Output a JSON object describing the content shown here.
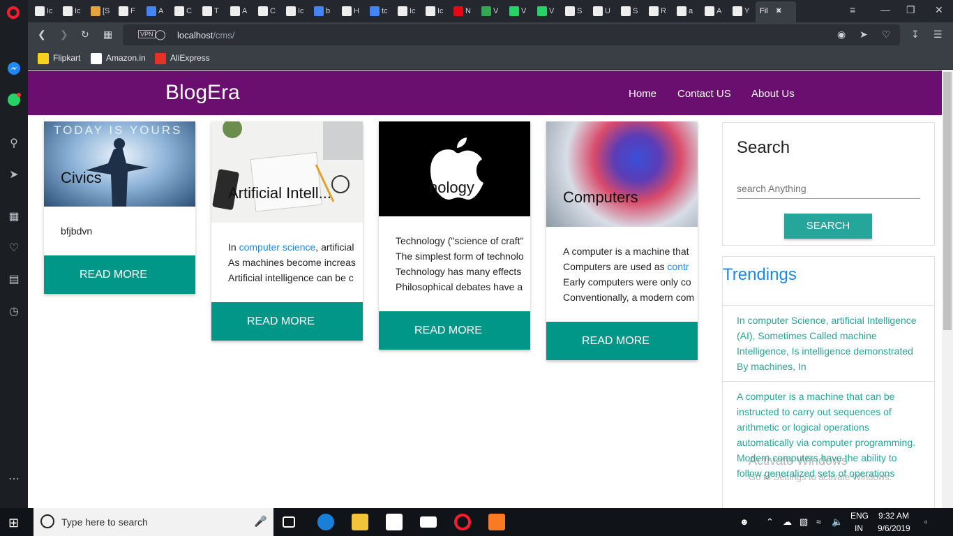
{
  "browser": {
    "url_host": "localhost",
    "url_path": "/cms/",
    "active_tab_label": "Fil",
    "tabs": [
      "Ic",
      "Ic",
      "[S",
      "F",
      "A",
      "C",
      "T",
      "A",
      "C",
      "Ic",
      "b",
      "H",
      "tc",
      "Ic",
      "Ic",
      "N",
      "V",
      "V",
      "V",
      "S",
      "U",
      "S",
      "R",
      "a",
      "A",
      "Y"
    ],
    "bookmarks": [
      "Flipkart",
      "Amazon.in",
      "AliExpress"
    ],
    "accent": "#ff1b2d"
  },
  "site": {
    "brand": "BlogEra",
    "nav": [
      "Home",
      "Contact US",
      "About Us"
    ],
    "navbar_color": "#6a0f6f",
    "button_color": "#009688"
  },
  "cards": [
    {
      "title": "Civics",
      "body": [
        "bfjbdvn"
      ],
      "button": "READ MORE",
      "image_text": "TODAY IS YOURS"
    },
    {
      "title": "Artificial Intell...",
      "body_prefix": "In ",
      "body_link": "computer science",
      "body_suffix": ", artificial",
      "body": [
        "As machines become increas",
        "Artificial intelligence can be c"
      ],
      "button": "READ MORE"
    },
    {
      "title": "nology",
      "body": [
        "Technology (\"science of craft\"",
        "The simplest form of technolo",
        "Technology has many effects",
        "Philosophical debates have a"
      ],
      "button": "READ MORE"
    },
    {
      "title": "Computers",
      "body_first": "A computer is a machine that",
      "body_link_prefix": "Computers are used as ",
      "body_link": "contr",
      "body": [
        "Early computers were only co",
        "Conventionally, a modern com"
      ],
      "button": "READ MORE"
    }
  ],
  "search": {
    "title": "Search",
    "placeholder": "search Anything",
    "button": "SEARCH"
  },
  "trending": {
    "title": "Trendings",
    "items": [
      "In computer Science, artificial Intelligence (AI), Sometimes Called machine Intelligence, Is intelligence demonstrated By machines, In",
      "A computer is a machine that can be instructed to carry out sequences of arithmetic or logical operations automatically via computer programming. Modern computers have the ability to follow generalized sets of operations"
    ]
  },
  "watermark": {
    "line1": "Activate Windows",
    "line2": "Go to Settings to activate Windows."
  },
  "taskbar": {
    "search_placeholder": "Type here to search",
    "time": "9:32 AM",
    "date": "9/6/2019",
    "lang1": "ENG",
    "lang2": "IN"
  }
}
